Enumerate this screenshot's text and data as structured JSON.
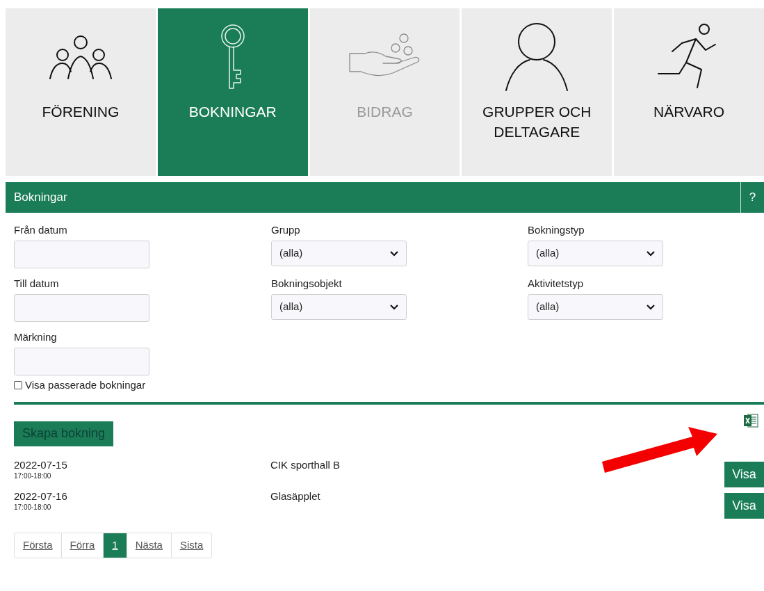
{
  "tiles": [
    {
      "label": "FÖRENING",
      "kind": "people",
      "selected": false,
      "disabled": false
    },
    {
      "label": "BOKNINGAR",
      "kind": "key",
      "selected": true,
      "disabled": false
    },
    {
      "label": "BIDRAG",
      "kind": "coins",
      "selected": false,
      "disabled": true
    },
    {
      "label": "GRUPPER OCH DELTAGARE",
      "kind": "person",
      "selected": false,
      "disabled": false
    },
    {
      "label": "NÄRVARO",
      "kind": "runner",
      "selected": false,
      "disabled": false
    }
  ],
  "panel": {
    "title": "Bokningar",
    "help": "?"
  },
  "filters": [
    {
      "kind": "text",
      "label": "Från datum"
    },
    {
      "kind": "select",
      "label": "Grupp",
      "value": "(alla)"
    },
    {
      "kind": "select",
      "label": "Bokningstyp",
      "value": "(alla)"
    },
    {
      "kind": "text",
      "label": "Till datum"
    },
    {
      "kind": "select",
      "label": "Bokningsobjekt",
      "value": "(alla)"
    },
    {
      "kind": "select",
      "label": "Aktivitetstyp",
      "value": "(alla)"
    },
    {
      "kind": "text",
      "label": "Märkning"
    }
  ],
  "show_past": {
    "label": "Visa passerade bokningar",
    "checked": false
  },
  "create_button": "Skapa bokning",
  "bookings": [
    {
      "date": "2022-07-15",
      "time": "17:00-18:00",
      "object": "CIK sporthall B",
      "action": "Visa"
    },
    {
      "date": "2022-07-16",
      "time": "17:00-18:00",
      "object": "Glasäpplet",
      "action": "Visa"
    }
  ],
  "pagination": [
    {
      "label": "Första",
      "selected": false
    },
    {
      "label": "Förra",
      "selected": false
    },
    {
      "label": "1",
      "selected": true
    },
    {
      "label": "Nästa",
      "selected": false
    },
    {
      "label": "Sista",
      "selected": false
    }
  ]
}
